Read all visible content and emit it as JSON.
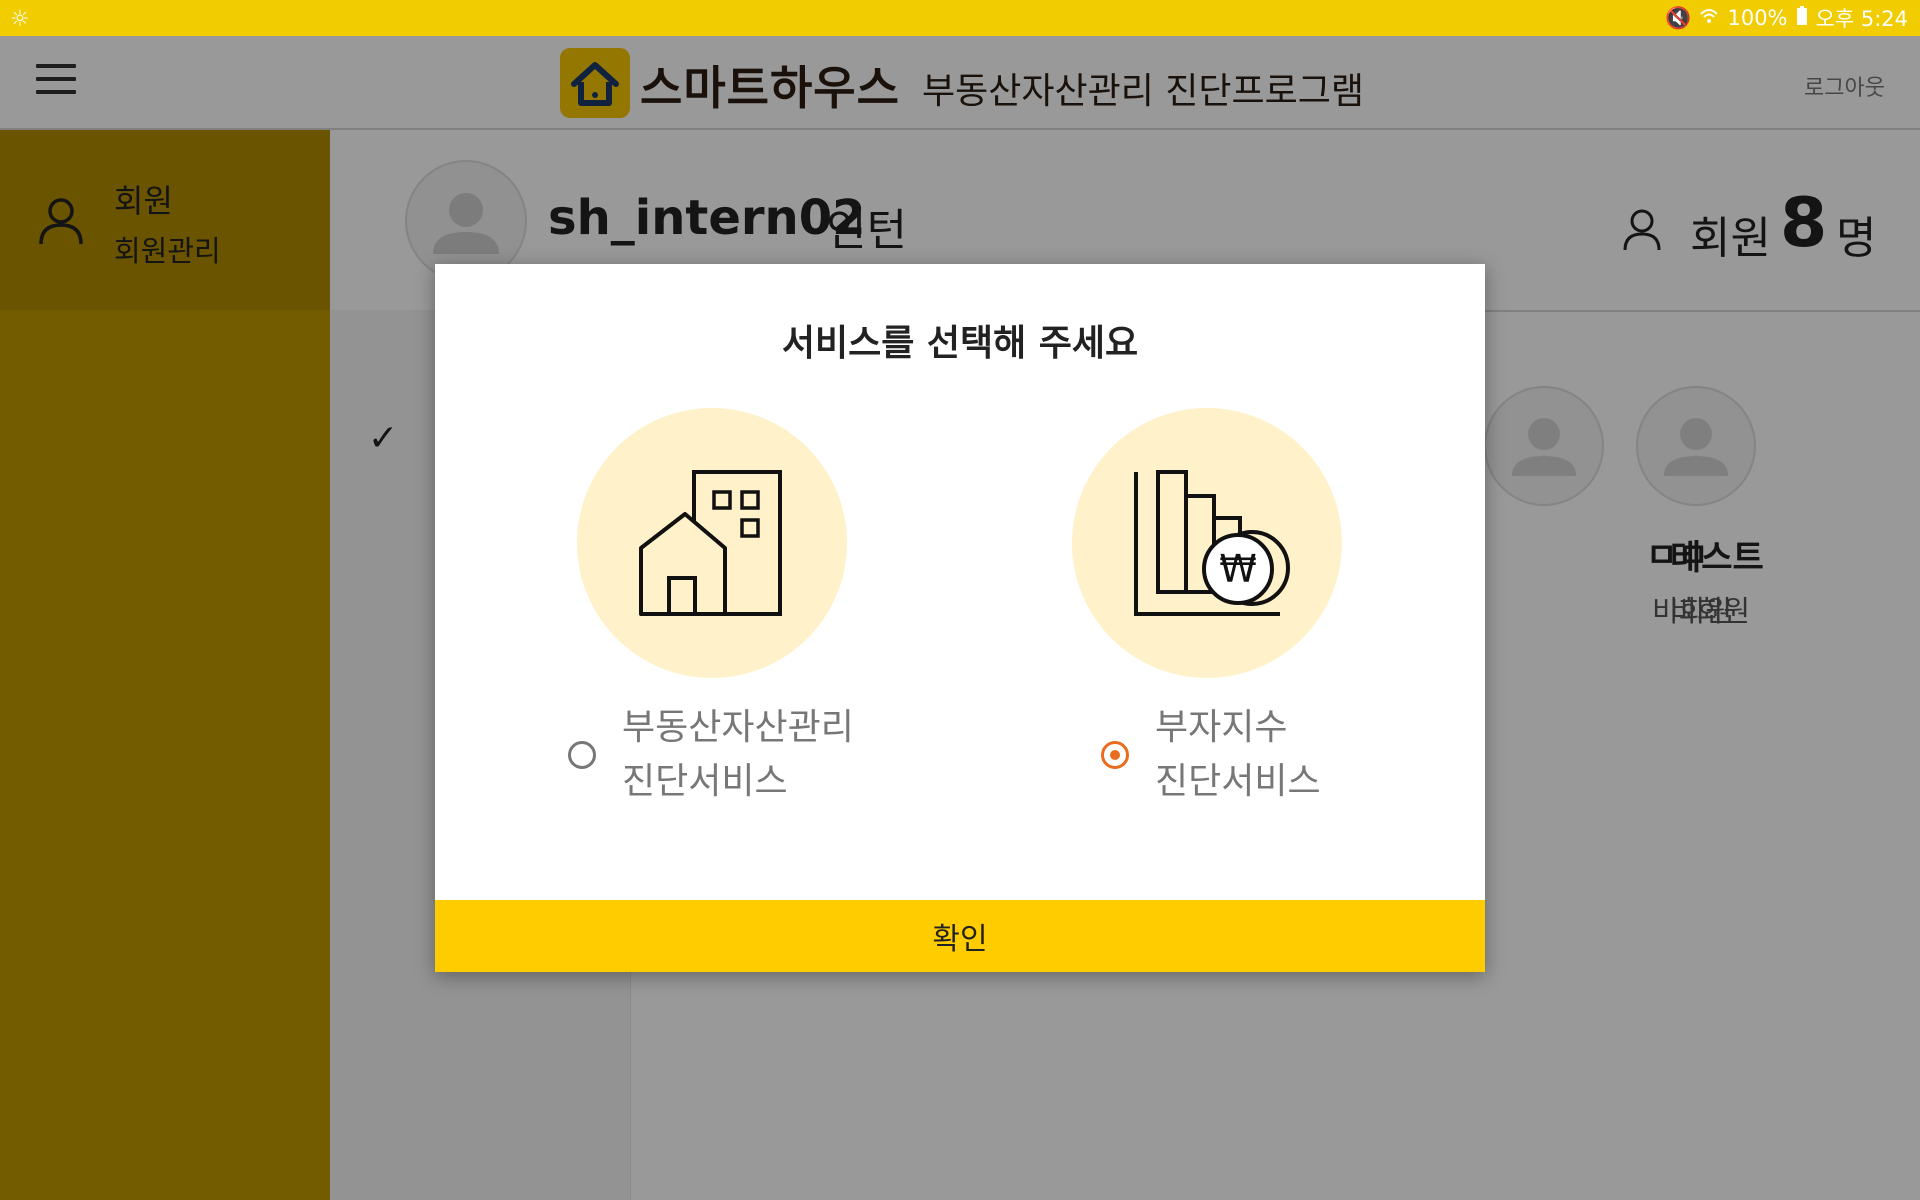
{
  "status_bar": {
    "battery": "100%",
    "time": "오후 5:24"
  },
  "header": {
    "brand": "스마트하우스",
    "subtitle": "부동산자산관리 진단프로그램",
    "logout": "로그아웃"
  },
  "sidebar": {
    "title": "회원",
    "subtitle": "회원관리"
  },
  "profile": {
    "username": "sh_intern02",
    "role": "인턴",
    "members_label": "회원",
    "members_count": "8",
    "members_unit": "명"
  },
  "members": [
    {
      "name": "ㅁㅁ",
      "role": "비회원"
    },
    {
      "name": "테스트",
      "role": "비회원"
    }
  ],
  "modal": {
    "title": "서비스를 선택해 주세요",
    "options": [
      {
        "line1": "부동산자산관리",
        "line2": "진단서비스",
        "selected": false,
        "icon": "buildings-icon"
      },
      {
        "line1": "부자지수",
        "line2": "진단서비스",
        "selected": true,
        "icon": "chart-coin-icon"
      }
    ],
    "confirm": "확인"
  },
  "colors": {
    "status_bar": "#f1cc00",
    "sidebar": "#c09800",
    "modal_button": "#ffcc00",
    "icon_circle": "#fff1c9",
    "radio_selected": "#e86d1f"
  }
}
